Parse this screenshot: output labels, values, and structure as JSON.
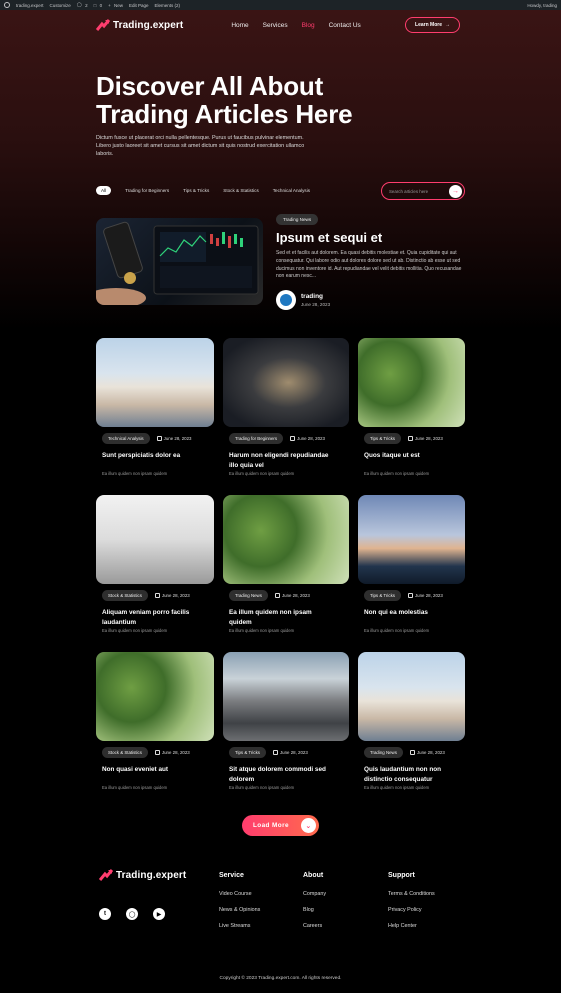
{
  "adminbar": {
    "site": "trading.expert",
    "customize": "Customize",
    "comments": "2",
    "updates": "0",
    "new": "New",
    "edit": "Edit Page",
    "elements": "Elements (2)",
    "howdy": "Howdy, trading"
  },
  "header": {
    "logo": "Trading.expert",
    "nav": [
      "Home",
      "Services",
      "Blog",
      "Contact Us"
    ],
    "active_nav": "Blog",
    "cta": "Learn More"
  },
  "hero": {
    "title_line1": "Discover All About",
    "title_line2": "Trading Articles Here",
    "desc_line1": "Dictum fusce ut placerat orci nulla pellentesque. Purus ut faucibus pulvinar elementum.",
    "desc_line2": "Libero justo laoreet sit amet cursus sit amet dictum sit quis nostrud exercitation ullamco",
    "desc_line3": "laboris."
  },
  "filters": [
    "All",
    "Trading for Beginners",
    "Tips & Tricks",
    "Stock & Statistics",
    "Technical Analysis"
  ],
  "search": {
    "placeholder": "Search articles here"
  },
  "featured": {
    "tag": "Trading News",
    "title": "Ipsum et sequi et",
    "desc": "Sed et et facilis aut dolorem. Ea quasi debitis molestiae et. Quia cupiditate qui aut consequatur. Qui labore odio aut dolores dolore sed ut ab. Distinctio ab esse ut sed ducimus non inventore id. Aut repudiandae vel velit debitis mollitia. Quo recusandae non earum nesc...",
    "author": "trading",
    "date": "June 28, 2023"
  },
  "cards": [
    {
      "tag": "Technical Analysis",
      "date": "June 28, 2023",
      "title": "Sunt perspiciatis dolor ea",
      "excerpt": "Ea illum quidem non ipsam quidem"
    },
    {
      "tag": "Trading for Beginners",
      "date": "June 28, 2023",
      "title": "Harum non eligendi repudiandae illo quia vel",
      "excerpt": "Ea illum quidem non ipsam quidem"
    },
    {
      "tag": "Tips & Tricks",
      "date": "June 28, 2023",
      "title": "Quos itaque ut est",
      "excerpt": "Ea illum quidem non ipsam quidem"
    },
    {
      "tag": "Stock & Statistics",
      "date": "June 28, 2023",
      "title": "Aliquam veniam porro facilis laudantium",
      "excerpt": "Ea illum quidem non ipsam quidem"
    },
    {
      "tag": "Trading News",
      "date": "June 28, 2023",
      "title": "Ea illum quidem non ipsam quidem",
      "excerpt": "Ea illum quidem non ipsam quidem"
    },
    {
      "tag": "Tips & Tricks",
      "date": "June 28, 2023",
      "title": "Non qui ea molestias",
      "excerpt": "Ea illum quidem non ipsam quidem"
    },
    {
      "tag": "Stock & Statistics",
      "date": "June 28, 2023",
      "title": "Non quasi eveniet aut",
      "excerpt": "Ea illum quidem non ipsam quidem"
    },
    {
      "tag": "Tips & Tricks",
      "date": "June 28, 2023",
      "title": "Sit atque dolorem commodi sed dolorem",
      "excerpt": "Ea illum quidem non ipsam quidem"
    },
    {
      "tag": "Trading News",
      "date": "June 28, 2023",
      "title": "Quis laudantium non non distinctio consequatur",
      "excerpt": "Ea illum quidem non ipsam quidem"
    }
  ],
  "load_more": "Load More",
  "footer": {
    "logo": "Trading.expert",
    "service": {
      "title": "Service",
      "links": [
        "Video Course",
        "News & Opinions",
        "Live Streams"
      ]
    },
    "about": {
      "title": "About",
      "links": [
        "Company",
        "Blog",
        "Careers"
      ]
    },
    "support": {
      "title": "Support",
      "links": [
        "Terms & Conditions",
        "Privacy Policy",
        "Help Center"
      ]
    },
    "copyright": "Copyright © 2023 Trading.expert.com. All rights reserved."
  },
  "colors": {
    "accent": "#ff3d6e",
    "background": "#000000",
    "hero_top": "#3a1414"
  }
}
